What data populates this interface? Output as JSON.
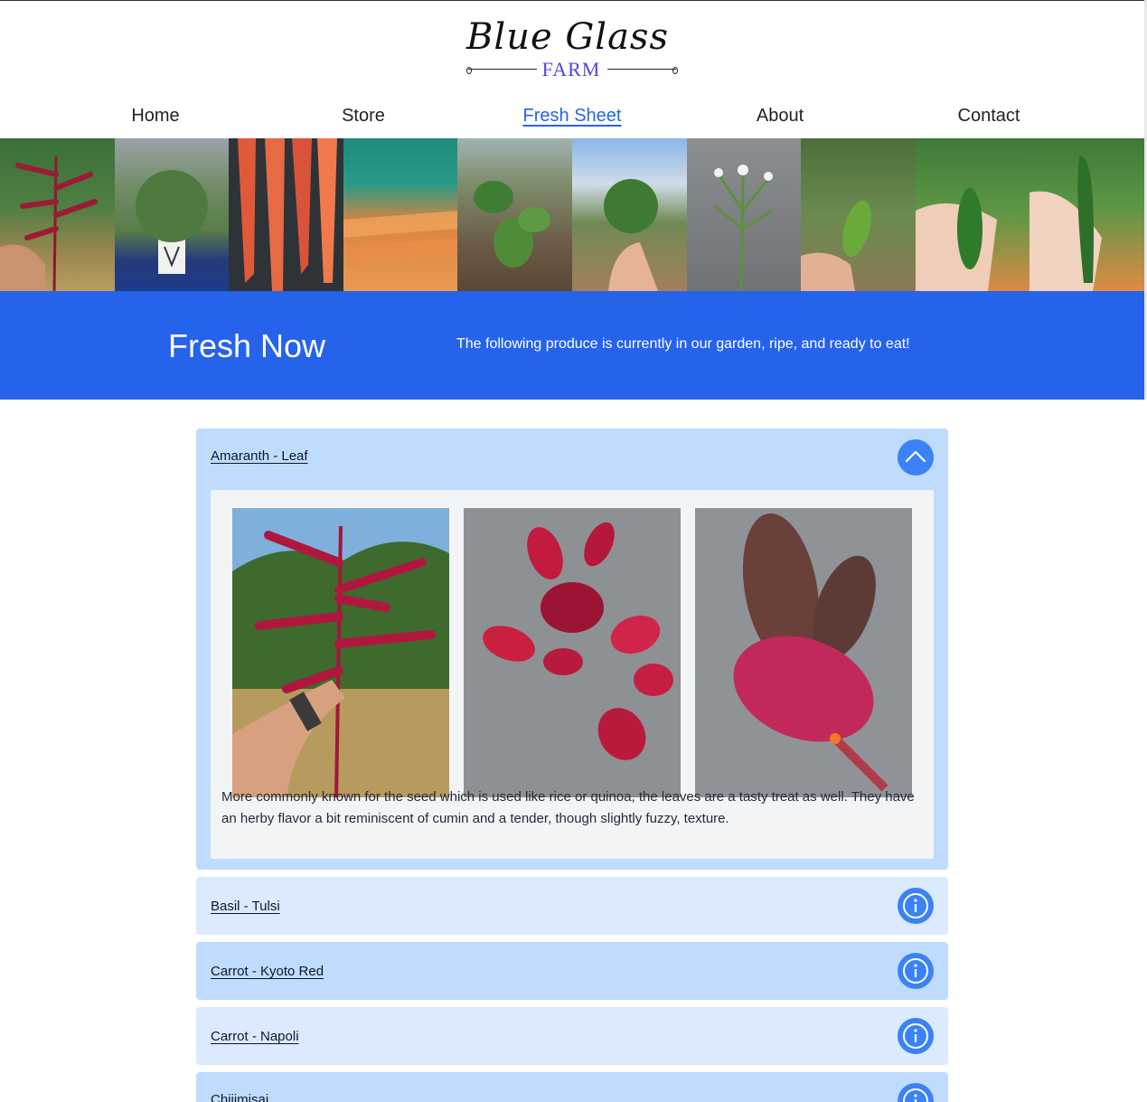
{
  "logo": {
    "title": "Blue Glass",
    "subtitle": "FARM"
  },
  "nav": {
    "items": [
      {
        "label": "Home"
      },
      {
        "label": "Store"
      },
      {
        "label": "Fresh Sheet"
      },
      {
        "label": "About"
      },
      {
        "label": "Contact"
      }
    ],
    "active": "Fresh Sheet"
  },
  "banner": {
    "title": "Fresh Now",
    "text": "The following produce is currently in our garden, ripe, and ready to eat!"
  },
  "produce": [
    {
      "name": "Amaranth - Leaf",
      "expanded": true,
      "description": "More commonly known for the seed which is used like rice or quinoa, the leaves are a tasty treat as well. They have an herby flavor a bit reminiscent of cumin and a tender, though slightly fuzzy, texture."
    },
    {
      "name": "Basil - Tulsi",
      "expanded": false
    },
    {
      "name": "Carrot - Kyoto Red",
      "expanded": false
    },
    {
      "name": "Carrot - Napoli",
      "expanded": false
    },
    {
      "name": "Chijimisai",
      "expanded": false
    }
  ],
  "icons": {
    "expanded": "chevron-up-icon",
    "collapsed": "info-icon"
  },
  "colors": {
    "accent": "#2563eb",
    "button": "#3b82f6",
    "card_mid": "#bfdbfe",
    "card_light": "#dbeafe"
  }
}
